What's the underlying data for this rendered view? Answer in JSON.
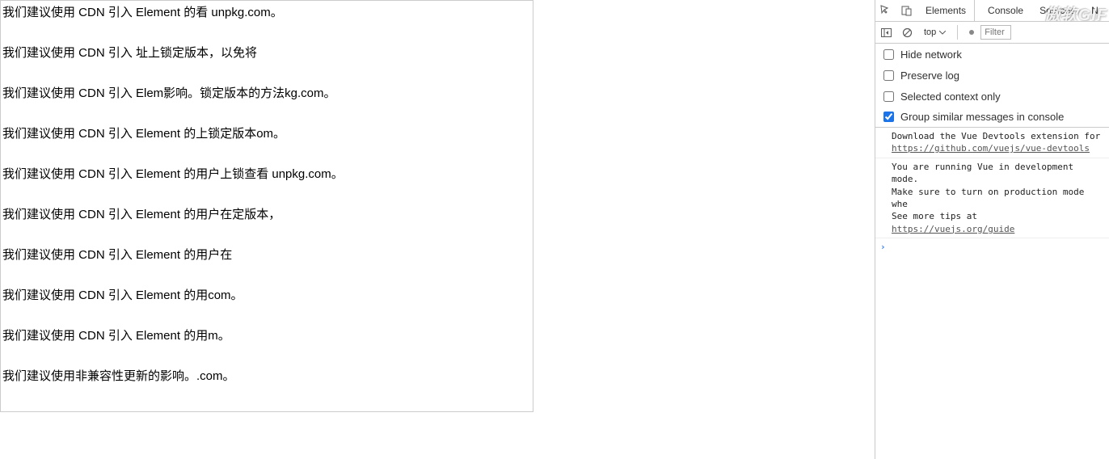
{
  "content": {
    "lines": [
      "我们建议使用 CDN 引入 Element 的看 unpkg.com。",
      "我们建议使用 CDN 引入 址上锁定版本，以免将",
      "我们建议使用 CDN 引入 Elem影响。锁定版本的方法kg.com。",
      "我们建议使用 CDN 引入 Element 的上锁定版本om。",
      "我们建议使用 CDN 引入 Element 的用户上锁查看 unpkg.com。",
      "我们建议使用 CDN 引入 Element 的用户在定版本，",
      "我们建议使用 CDN 引入 Element 的用户在",
      "我们建议使用 CDN 引入 Element 的用com。",
      "我们建议使用 CDN 引入 Element 的用m。",
      "我们建议使用非兼容性更新的影响。.com。"
    ]
  },
  "devtools": {
    "tabs": {
      "elements": "Elements",
      "console": "Console",
      "sources": "Sources",
      "network": "N"
    },
    "context": "top",
    "filter_placeholder": "Filter",
    "checkboxes": {
      "hide_network": {
        "label": "Hide network",
        "checked": false
      },
      "preserve_log": {
        "label": "Preserve log",
        "checked": false
      },
      "selected_context": {
        "label": "Selected context only",
        "checked": false
      },
      "group_similar": {
        "label": "Group similar messages in console",
        "checked": true
      }
    },
    "console": {
      "msg1_text": "Download the Vue Devtools extension for",
      "msg1_link": "https://github.com/vuejs/vue-devtools",
      "msg2_line1": "You are running Vue in development mode.",
      "msg2_line2": "Make sure to turn on production mode whe",
      "msg2_line3a": "See more tips at ",
      "msg2_link": "https://vuejs.org/guide"
    },
    "prompt": "›"
  },
  "watermark": "傲软GIF"
}
